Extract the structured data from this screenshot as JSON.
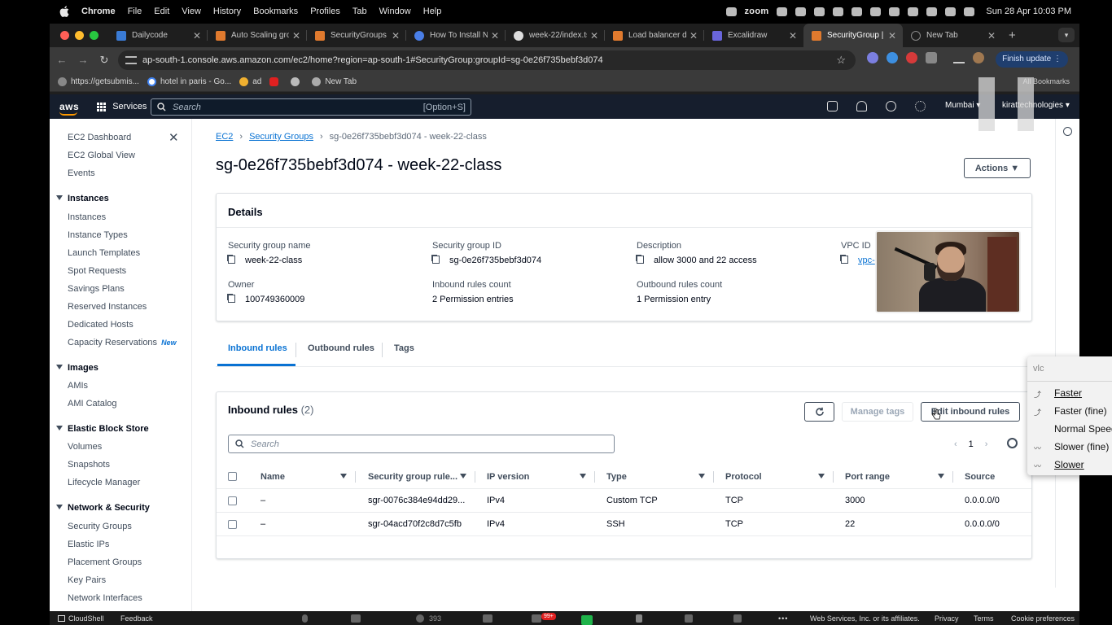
{
  "menubar": {
    "app": "Chrome",
    "items": [
      "File",
      "Edit",
      "View",
      "History",
      "Bookmarks",
      "Profiles",
      "Tab",
      "Window",
      "Help"
    ],
    "status_zoom": "zoom",
    "clock": "Sun 28 Apr  10:03 PM"
  },
  "tabs": [
    {
      "title": "Dailycode",
      "fav_color": "#3a7bd5"
    },
    {
      "title": "Auto Scaling gro",
      "fav_color": "#e07a2e"
    },
    {
      "title": "SecurityGroups |",
      "fav_color": "#e07a2e"
    },
    {
      "title": "How To Install Nc",
      "fav_color": "#4a7fe8"
    },
    {
      "title": "week-22/index.ts",
      "fav_color": "#dddddd"
    },
    {
      "title": "Load balancer de",
      "fav_color": "#e07a2e"
    },
    {
      "title": "Excalidraw",
      "fav_color": "#6965db"
    },
    {
      "title": "SecurityGroup | E",
      "fav_color": "#e07a2e",
      "active": true
    },
    {
      "title": "New Tab",
      "fav_color": "#888888"
    }
  ],
  "toolbar": {
    "url": "ap-south-1.console.aws.amazon.com/ec2/home?region=ap-south-1#SecurityGroup:groupId=sg-0e26f735bebf3d074",
    "finish_update": "Finish update"
  },
  "bookmarks": {
    "items": [
      "https://getsubmis...",
      "hotel in paris - Go...",
      "ad",
      "",
      "",
      "New Tab"
    ],
    "all": "All Bookmarks"
  },
  "aws_nav": {
    "logo": "aws",
    "services": "Services",
    "search_placeholder": "Search",
    "search_shortcut": "[Option+S]",
    "region": "Mumbai ▾",
    "account": "kirattechnologies ▾"
  },
  "sidebar": {
    "top": [
      "EC2 Dashboard",
      "EC2 Global View",
      "Events"
    ],
    "sections": [
      {
        "title": "Instances",
        "items": [
          "Instances",
          "Instance Types",
          "Launch Templates",
          "Spot Requests",
          "Savings Plans",
          "Reserved Instances",
          "Dedicated Hosts",
          "Capacity Reservations"
        ]
      },
      {
        "title": "Images",
        "items": [
          "AMIs",
          "AMI Catalog"
        ]
      },
      {
        "title": "Elastic Block Store",
        "items": [
          "Volumes",
          "Snapshots",
          "Lifecycle Manager"
        ]
      },
      {
        "title": "Network & Security",
        "items": [
          "Security Groups",
          "Elastic IPs",
          "Placement Groups",
          "Key Pairs",
          "Network Interfaces"
        ]
      }
    ],
    "new_badge": "New"
  },
  "breadcrumb": {
    "ec2": "EC2",
    "sg": "Security Groups",
    "current": "sg-0e26f735bebf3d074 - week-22-class"
  },
  "page_title": "sg-0e26f735bebf3d074 - week-22-class",
  "actions_label": "Actions ▼",
  "details": {
    "title": "Details",
    "sg_name_label": "Security group name",
    "sg_name": "week-22-class",
    "sg_id_label": "Security group ID",
    "sg_id": "sg-0e26f735bebf3d074",
    "desc_label": "Description",
    "desc": "allow 3000 and 22 access",
    "vpc_label": "VPC ID",
    "vpc": "vpc-",
    "owner_label": "Owner",
    "owner": "100749360009",
    "inbound_label": "Inbound rules count",
    "inbound": "2 Permission entries",
    "outbound_label": "Outbound rules count",
    "outbound": "1 Permission entry"
  },
  "content_tabs": [
    "Inbound rules",
    "Outbound rules",
    "Tags"
  ],
  "rules": {
    "title": "Inbound rules",
    "count": "(2)",
    "manage_tags": "Manage tags",
    "edit": "Edit inbound rules",
    "search_placeholder": "Search",
    "page": "1",
    "columns": [
      "Name",
      "Security group rule...",
      "IP version",
      "Type",
      "Protocol",
      "Port range",
      "Source"
    ],
    "rows": [
      [
        "–",
        "sgr-0076c384e94dd29...",
        "IPv4",
        "Custom TCP",
        "TCP",
        "3000",
        "0.0.0.0/0"
      ],
      [
        "–",
        "sgr-04acd70f2c8d7c5fb",
        "IPv4",
        "SSH",
        "TCP",
        "22",
        "0.0.0.0/0"
      ]
    ]
  },
  "vlc_menu": {
    "header": "vlc",
    "items": [
      "Faster",
      "Faster (fine)",
      "Normal Speed",
      "Slower (fine)",
      "Slower"
    ]
  },
  "bottom_bar": {
    "cloudshell": "CloudShell",
    "feedback": "Feedback",
    "participants": "393",
    "chat_badge": "99+",
    "copyright": "Web Services, Inc. or its affiliates.",
    "privacy": "Privacy",
    "terms": "Terms",
    "cookies": "Cookie preferences"
  }
}
